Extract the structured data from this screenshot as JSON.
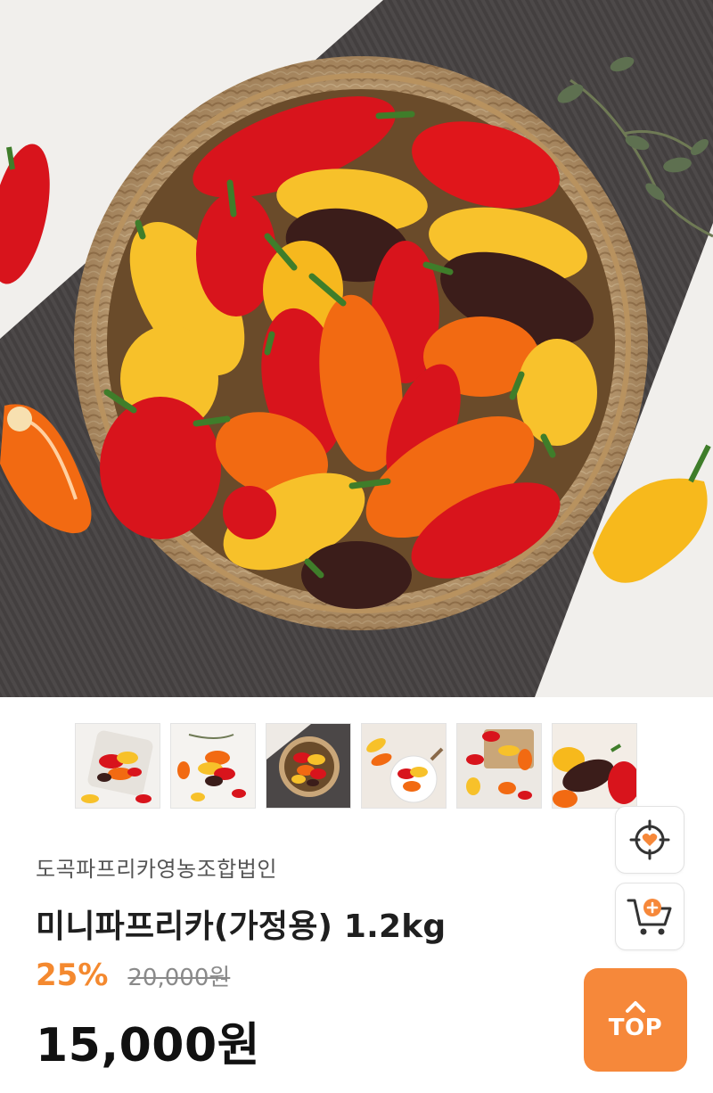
{
  "hero": {
    "image_icon": "mini-paprika-basket-photo"
  },
  "thumbnails": [
    {
      "icon": "paprika-thumb-1"
    },
    {
      "icon": "paprika-thumb-2"
    },
    {
      "icon": "paprika-thumb-3"
    },
    {
      "icon": "paprika-thumb-4"
    },
    {
      "icon": "paprika-thumb-5"
    },
    {
      "icon": "paprika-thumb-6"
    }
  ],
  "product": {
    "seller": "도곡파프리카영농조합법인",
    "title": "미니파프리카(가정용) 1.2kg",
    "discount_rate": "25%",
    "original_price": "20,000원",
    "sale_price": "15,000원"
  },
  "floating_buttons": {
    "target_icon": "crosshair-heart-icon",
    "cart_icon": "cart-add-icon",
    "top_label": "TOP"
  },
  "colors": {
    "accent": "#f6883a",
    "discount": "#f4892f",
    "pepper_red": "#d8141c",
    "pepper_orange": "#f26a12",
    "pepper_yellow": "#f7c12a",
    "pepper_brown": "#3b1d1a",
    "basket": "#c9a679",
    "mat": "#4b4747"
  }
}
